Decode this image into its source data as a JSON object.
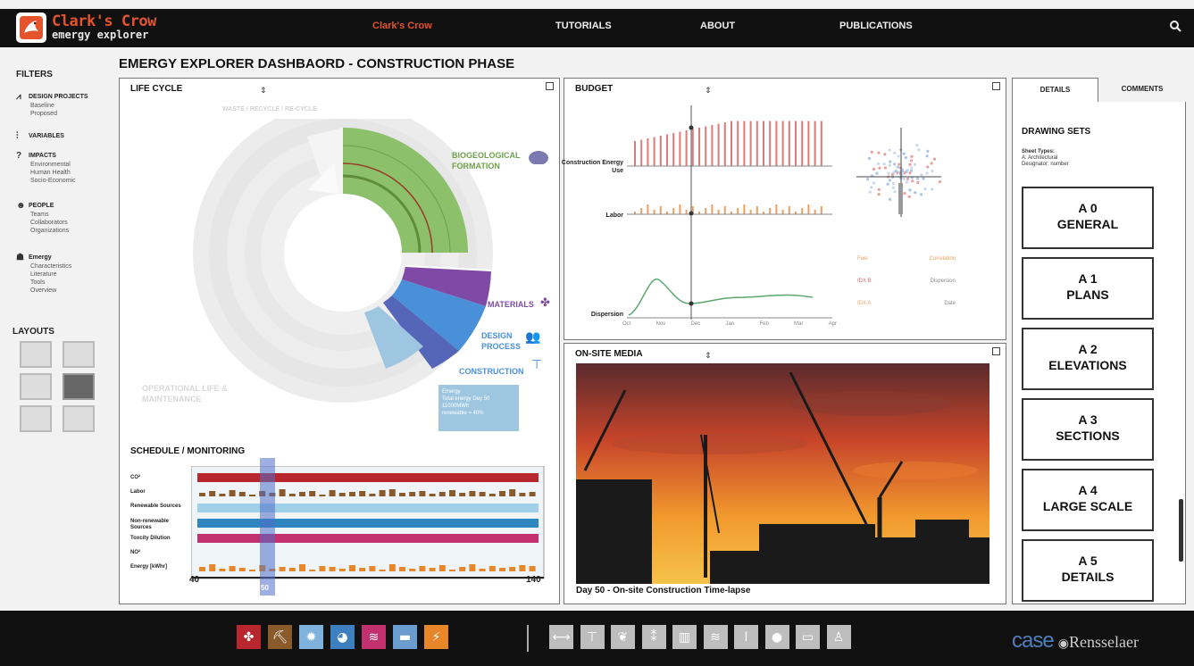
{
  "app": {
    "logo_title": "Clark's Crow",
    "logo_subtitle": "emergy explorer"
  },
  "nav": {
    "items": [
      "Clark's Crow",
      "TUTORIALS",
      "ABOUT",
      "PUBLICATIONS"
    ],
    "active": "Clark's Crow"
  },
  "page_title": "EMERGY EXPLORER DASHBAORD - CONSTRUCTION PHASE",
  "sidebar": {
    "filters_heading": "FILTERS",
    "groups": [
      {
        "title": "DESIGN PROJECTS",
        "icon": "line-chart-icon",
        "items": [
          "Baseline",
          "Proposed"
        ]
      },
      {
        "title": "VARIABLES",
        "icon": "sliders-icon",
        "items": []
      },
      {
        "title": "IMPACTS",
        "icon": "question-icon",
        "items": [
          "Environmental",
          "Human Health",
          "Socio-Economic"
        ]
      },
      {
        "title": "PEOPLE",
        "icon": "people-icon",
        "items": [
          "Teams",
          "Collaborators",
          "Organizations"
        ]
      },
      {
        "title": "Emergy",
        "icon": "head-icon",
        "items": [
          "Characteristics",
          "Literature",
          "Tools",
          "Overview"
        ]
      }
    ],
    "layouts_heading": "LAYOUTS"
  },
  "life_cycle": {
    "title": "LIFE CYCLE",
    "phase_labels": {
      "waste": "WASTE / RECYCLE / RE-CYCLE",
      "biogeo": "BIOGEOLOGICAL FORMATION",
      "materials": "MATERIALS",
      "design": "DESIGN PROCESS",
      "construction": "CONSTRUCTION",
      "operational": "OPERATIONAL LIFE & MAINTENANCE"
    },
    "tooltip": {
      "title": "Emergy",
      "line1": "Total energy Day 50",
      "line2": "11000MWh",
      "line3": "renewable = 40%"
    }
  },
  "schedule": {
    "title": "SCHEDULE / MONITORING",
    "rows": [
      "CO²",
      "Labor",
      "Renewable Sources",
      "Non-renewable Sources",
      "Toxcity Dilution",
      "NO²",
      "Energy [kWhr]"
    ],
    "axis_start": "40",
    "axis_end": "140",
    "selected": "50"
  },
  "budget": {
    "title": "BUDGET",
    "row_labels": [
      "Construction Energy Use",
      "Labor",
      "Dispersion"
    ],
    "months": [
      "Oct",
      "Nov",
      "Dec",
      "Jan",
      "Feb",
      "Mar",
      "Apr"
    ],
    "legend": [
      "Fuel",
      "Correlation",
      "IDX B",
      "Dispersion",
      "IDX A",
      "Date"
    ]
  },
  "media": {
    "title": "ON-SITE MEDIA",
    "caption": "Day 50 - On-site Construction Time-lapse"
  },
  "details": {
    "tabs": [
      "DETAILS",
      "COMMENTS"
    ],
    "active_tab": "DETAILS",
    "drawing_sets_title": "DRAWING SETS",
    "meta": {
      "line1": "Sheet Types:",
      "line2": "A: Architectural",
      "line3": "Designator: number"
    },
    "sets": [
      {
        "code": "A 0",
        "name": "GENERAL"
      },
      {
        "code": "A 1",
        "name": "PLANS"
      },
      {
        "code": "A 2",
        "name": "ELEVATIONS"
      },
      {
        "code": "A 3",
        "name": "SECTIONS"
      },
      {
        "code": "A 4",
        "name": "LARGE SCALE"
      },
      {
        "code": "A 5",
        "name": "DETAILS"
      }
    ]
  },
  "bottom_bar": {
    "phase_icons": [
      {
        "name": "materials-icon",
        "color": "#b8272e"
      },
      {
        "name": "worker-icon",
        "color": "#8a5a2b"
      },
      {
        "name": "sun-icon",
        "color": "#7fb3dd"
      },
      {
        "name": "earth-icon",
        "color": "#3d7fbf"
      },
      {
        "name": "wind-icon",
        "color": "#c2306e"
      },
      {
        "name": "truck-icon",
        "color": "#6b9ccf"
      },
      {
        "name": "lightning-icon",
        "color": "#e8872a"
      }
    ],
    "resource_icons": [
      "steel-icon",
      "crane-icon",
      "leaf-icon",
      "wheat-icon",
      "trash-icon",
      "wind-lines-icon",
      "beam-icon",
      "water-drop-icon",
      "panel-icon",
      "person-icon"
    ],
    "brand_case": "case",
    "brand_rpi": "Rensselaer"
  },
  "colors": {
    "accent": "#e4532b",
    "biogeo": "#8cc06a",
    "materials": "#7e4aa6",
    "design": "#4a90d9",
    "construction": "#5566b8",
    "co2": "#b8272e",
    "renewable": "#9fd0e8",
    "nonrenewable": "#2e86c1",
    "toxicity": "#c2306e"
  }
}
